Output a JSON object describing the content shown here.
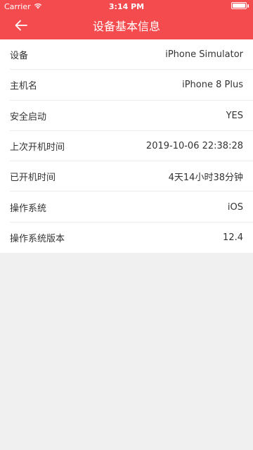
{
  "status_bar": {
    "carrier": "Carrier",
    "time": "3:14 PM"
  },
  "nav": {
    "title": "设备基本信息",
    "back_icon": "arrow-left-icon"
  },
  "device_info": [
    {
      "label": "设备",
      "value": "iPhone Simulator"
    },
    {
      "label": "主机名",
      "value": "iPhone 8 Plus"
    },
    {
      "label": "安全启动",
      "value": "YES"
    },
    {
      "label": "上次开机时间",
      "value": "2019-10-06 22:38:28"
    },
    {
      "label": "已开机时间",
      "value": "4天14小时38分钟"
    },
    {
      "label": "操作系统",
      "value": "iOS"
    },
    {
      "label": "操作系统版本",
      "value": "12.4"
    }
  ],
  "colors": {
    "header": "#f44b4e",
    "background": "#f0f0f0"
  }
}
